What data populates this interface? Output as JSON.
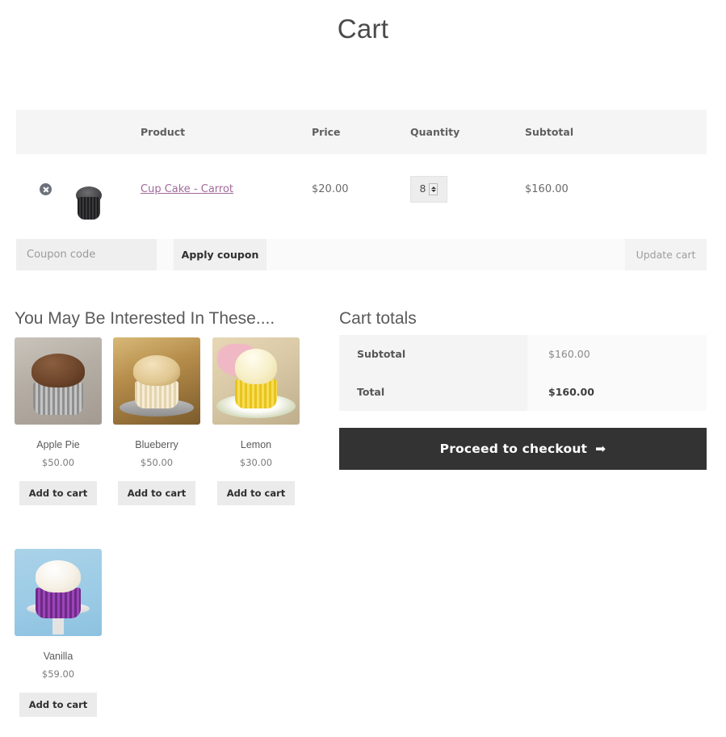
{
  "page": {
    "title": "Cart"
  },
  "cart_table": {
    "headers": {
      "remove": "",
      "thumbnail": "",
      "product": "Product",
      "price": "Price",
      "quantity": "Quantity",
      "subtotal": "Subtotal"
    },
    "items": [
      {
        "remove_icon": "remove-circle-icon",
        "thumbnail_icon": "cupcake-thumbnail",
        "name": "Cup Cake - Carrot",
        "price": "$20.00",
        "quantity": "8",
        "subtotal": "$160.00"
      }
    ]
  },
  "coupon": {
    "placeholder": "Coupon code",
    "value": "",
    "apply_label": "Apply coupon",
    "update_label": "Update cart"
  },
  "related": {
    "heading": "You May Be Interested In These....",
    "products": [
      {
        "name": "Apple Pie",
        "price": "$50.00",
        "button": "Add to cart",
        "image": "chocolate-cupcake-image"
      },
      {
        "name": "Blueberry",
        "price": "$50.00",
        "button": "Add to cart",
        "image": "blueberry-muffin-image"
      },
      {
        "name": "Lemon",
        "price": "$30.00",
        "button": "Add to cart",
        "image": "lemon-cupcake-image"
      },
      {
        "name": "Vanilla",
        "price": "$59.00",
        "button": "Add to cart",
        "image": "vanilla-cupcake-image"
      }
    ]
  },
  "totals": {
    "heading": "Cart totals",
    "rows": [
      {
        "label": "Subtotal",
        "value": "$160.00"
      },
      {
        "label": "Total",
        "value": "$160.00"
      }
    ],
    "checkout_label": "Proceed to checkout",
    "checkout_arrow": "➡"
  },
  "colors": {
    "link": "#a06a9a",
    "checkout_bg": "#333333",
    "header_bg": "#f5f5f5",
    "button_bg": "#ebebeb"
  }
}
